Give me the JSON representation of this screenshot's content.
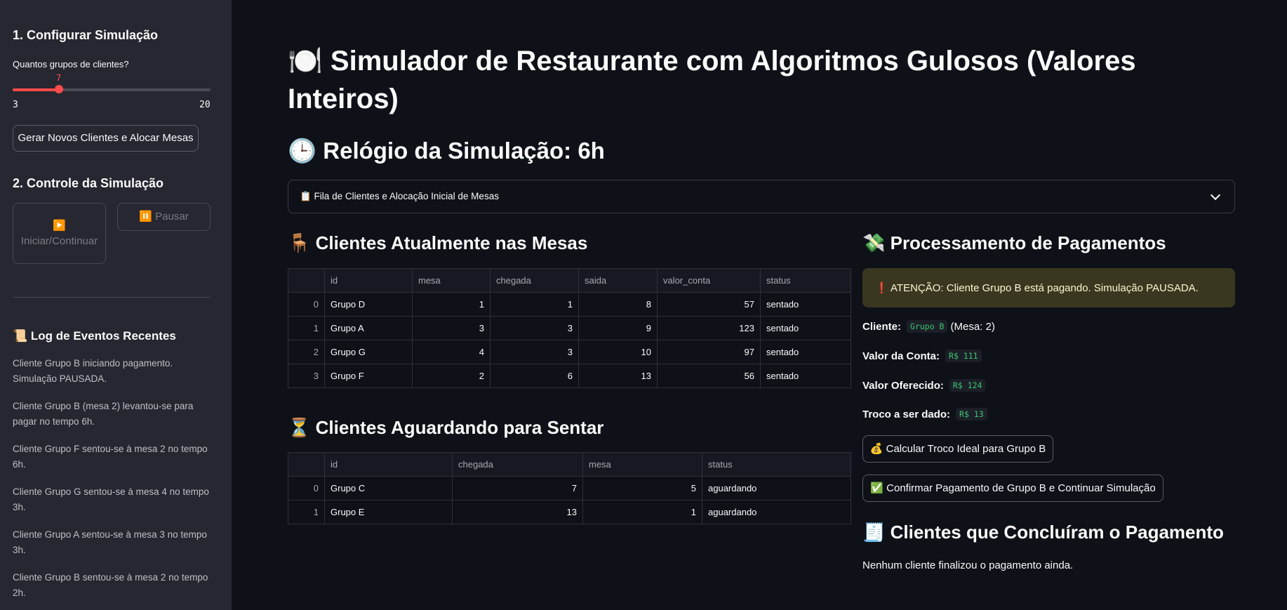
{
  "sidebar": {
    "section1_title": "1. Configurar Simulação",
    "slider": {
      "label": "Quantos grupos de clientes?",
      "value": "7",
      "min": "3",
      "max": "20",
      "fraction": 0.235
    },
    "generate_button": "Gerar Novos Clientes e Alocar Mesas",
    "section2_title": "2. Controle da Simulação",
    "start_button": "▶️ Iniciar/Continuar",
    "pause_button": "⏸️ Pausar",
    "log_title": "📜 Log de Eventos Recentes",
    "log": [
      "Cliente Grupo B iniciando pagamento. Simulação PAUSADA.",
      "Cliente Grupo B (mesa 2) levantou-se para pagar no tempo 6h.",
      "Cliente Grupo F sentou-se à mesa 2 no tempo 6h.",
      "Cliente Grupo G sentou-se à mesa 4 no tempo 3h.",
      "Cliente Grupo A sentou-se à mesa 3 no tempo 3h.",
      "Cliente Grupo B sentou-se à mesa 2 no tempo 2h."
    ]
  },
  "main": {
    "title": "🍽️ Simulador de Restaurante com Algoritmos Gulosos (Valores Inteiros)",
    "clock": "🕒 Relógio da Simulação: 6h",
    "expander": "📋 Fila de Clientes e Alocação Inicial de Mesas",
    "seated": {
      "title": "🪑 Clientes Atualmente nas Mesas",
      "columns": [
        "",
        "id",
        "mesa",
        "chegada",
        "saida",
        "valor_conta",
        "status"
      ],
      "rows": [
        [
          "0",
          "Grupo D",
          "1",
          "1",
          "8",
          "57",
          "sentado"
        ],
        [
          "1",
          "Grupo A",
          "3",
          "3",
          "9",
          "123",
          "sentado"
        ],
        [
          "2",
          "Grupo G",
          "4",
          "3",
          "10",
          "97",
          "sentado"
        ],
        [
          "3",
          "Grupo F",
          "2",
          "6",
          "13",
          "56",
          "sentado"
        ]
      ]
    },
    "waiting": {
      "title": "⏳ Clientes Aguardando para Sentar",
      "columns": [
        "",
        "id",
        "chegada",
        "mesa",
        "status"
      ],
      "rows": [
        [
          "0",
          "Grupo C",
          "7",
          "5",
          "aguardando"
        ],
        [
          "1",
          "Grupo E",
          "13",
          "1",
          "aguardando"
        ]
      ]
    },
    "payments": {
      "title": "💸 Processamento de Pagamentos",
      "alert": "❗ ATENÇÃO: Cliente Grupo B está pagando. Simulação PAUSADA.",
      "client_label": "Cliente:",
      "client_value": "Grupo B",
      "client_table": "(Mesa: 2)",
      "bill_label": "Valor da Conta:",
      "bill_value": "R$ 111",
      "offered_label": "Valor Oferecido:",
      "offered_value": "R$ 124",
      "change_label": "Troco a ser dado:",
      "change_value": "R$ 13",
      "calc_button": "💰 Calcular Troco Ideal para Grupo B",
      "confirm_button": "✅ Confirmar Pagamento de Grupo B e Continuar Simulação"
    },
    "done": {
      "title": "🧾 Clientes que Concluíram o Pagamento",
      "note": "Nenhum cliente finalizou o pagamento ainda."
    }
  }
}
